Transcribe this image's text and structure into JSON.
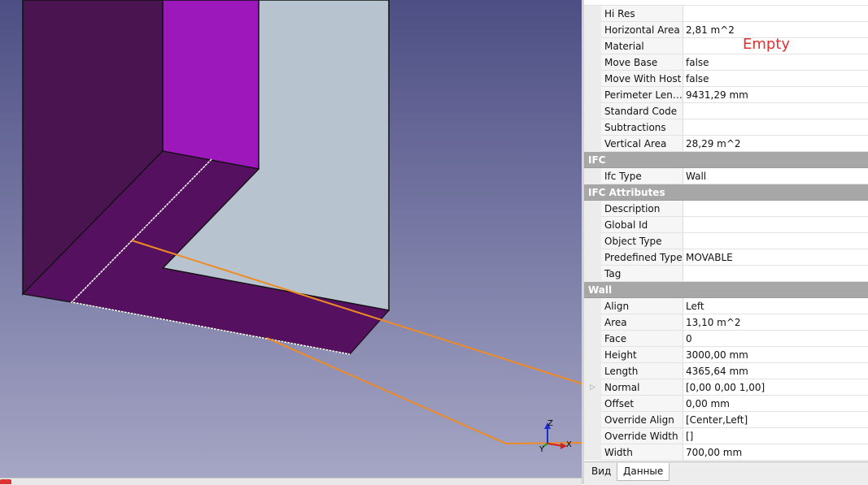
{
  "annotation": {
    "empty_label": "Empty"
  },
  "axis": {
    "z": "Z",
    "y": "Y",
    "x": "X"
  },
  "properties": {
    "rows_top": [
      {
        "name": "Hi Res",
        "value": ""
      },
      {
        "name": "Horizontal Area",
        "value": "2,81 m^2"
      },
      {
        "name": "Material",
        "value": ""
      },
      {
        "name": "Move Base",
        "value": "false"
      },
      {
        "name": "Move With Host",
        "value": "false"
      },
      {
        "name": "Perimeter Leng...",
        "value": "9431,29 mm"
      },
      {
        "name": "Standard Code",
        "value": ""
      },
      {
        "name": "Subtractions",
        "value": ""
      },
      {
        "name": "Vertical Area",
        "value": "28,29 m^2"
      }
    ],
    "group_ifc": "IFC",
    "rows_ifc": [
      {
        "name": "Ifc Type",
        "value": "Wall"
      }
    ],
    "group_ifc_attributes": "IFC Attributes",
    "rows_ifc_attributes": [
      {
        "name": "Description",
        "value": ""
      },
      {
        "name": "Global Id",
        "value": ""
      },
      {
        "name": "Object Type",
        "value": ""
      },
      {
        "name": "Predefined Type",
        "value": "MOVABLE"
      },
      {
        "name": "Tag",
        "value": ""
      }
    ],
    "group_wall": "Wall",
    "rows_wall": [
      {
        "name": "Align",
        "value": "Left"
      },
      {
        "name": "Area",
        "value": "13,10 m^2"
      },
      {
        "name": "Face",
        "value": "0"
      },
      {
        "name": "Height",
        "value": "3000,00 mm"
      },
      {
        "name": "Length",
        "value": "4365,64 mm"
      },
      {
        "name": "Normal",
        "value": "[0,00 0,00 1,00]"
      },
      {
        "name": "Offset",
        "value": "0,00 mm"
      },
      {
        "name": "Override Align",
        "value": "[Center,Left]"
      },
      {
        "name": "Override Width",
        "value": "[]"
      },
      {
        "name": "Width",
        "value": "700,00 mm"
      }
    ]
  },
  "tabs": [
    {
      "label": "Вид"
    },
    {
      "label": "Данные"
    }
  ]
}
